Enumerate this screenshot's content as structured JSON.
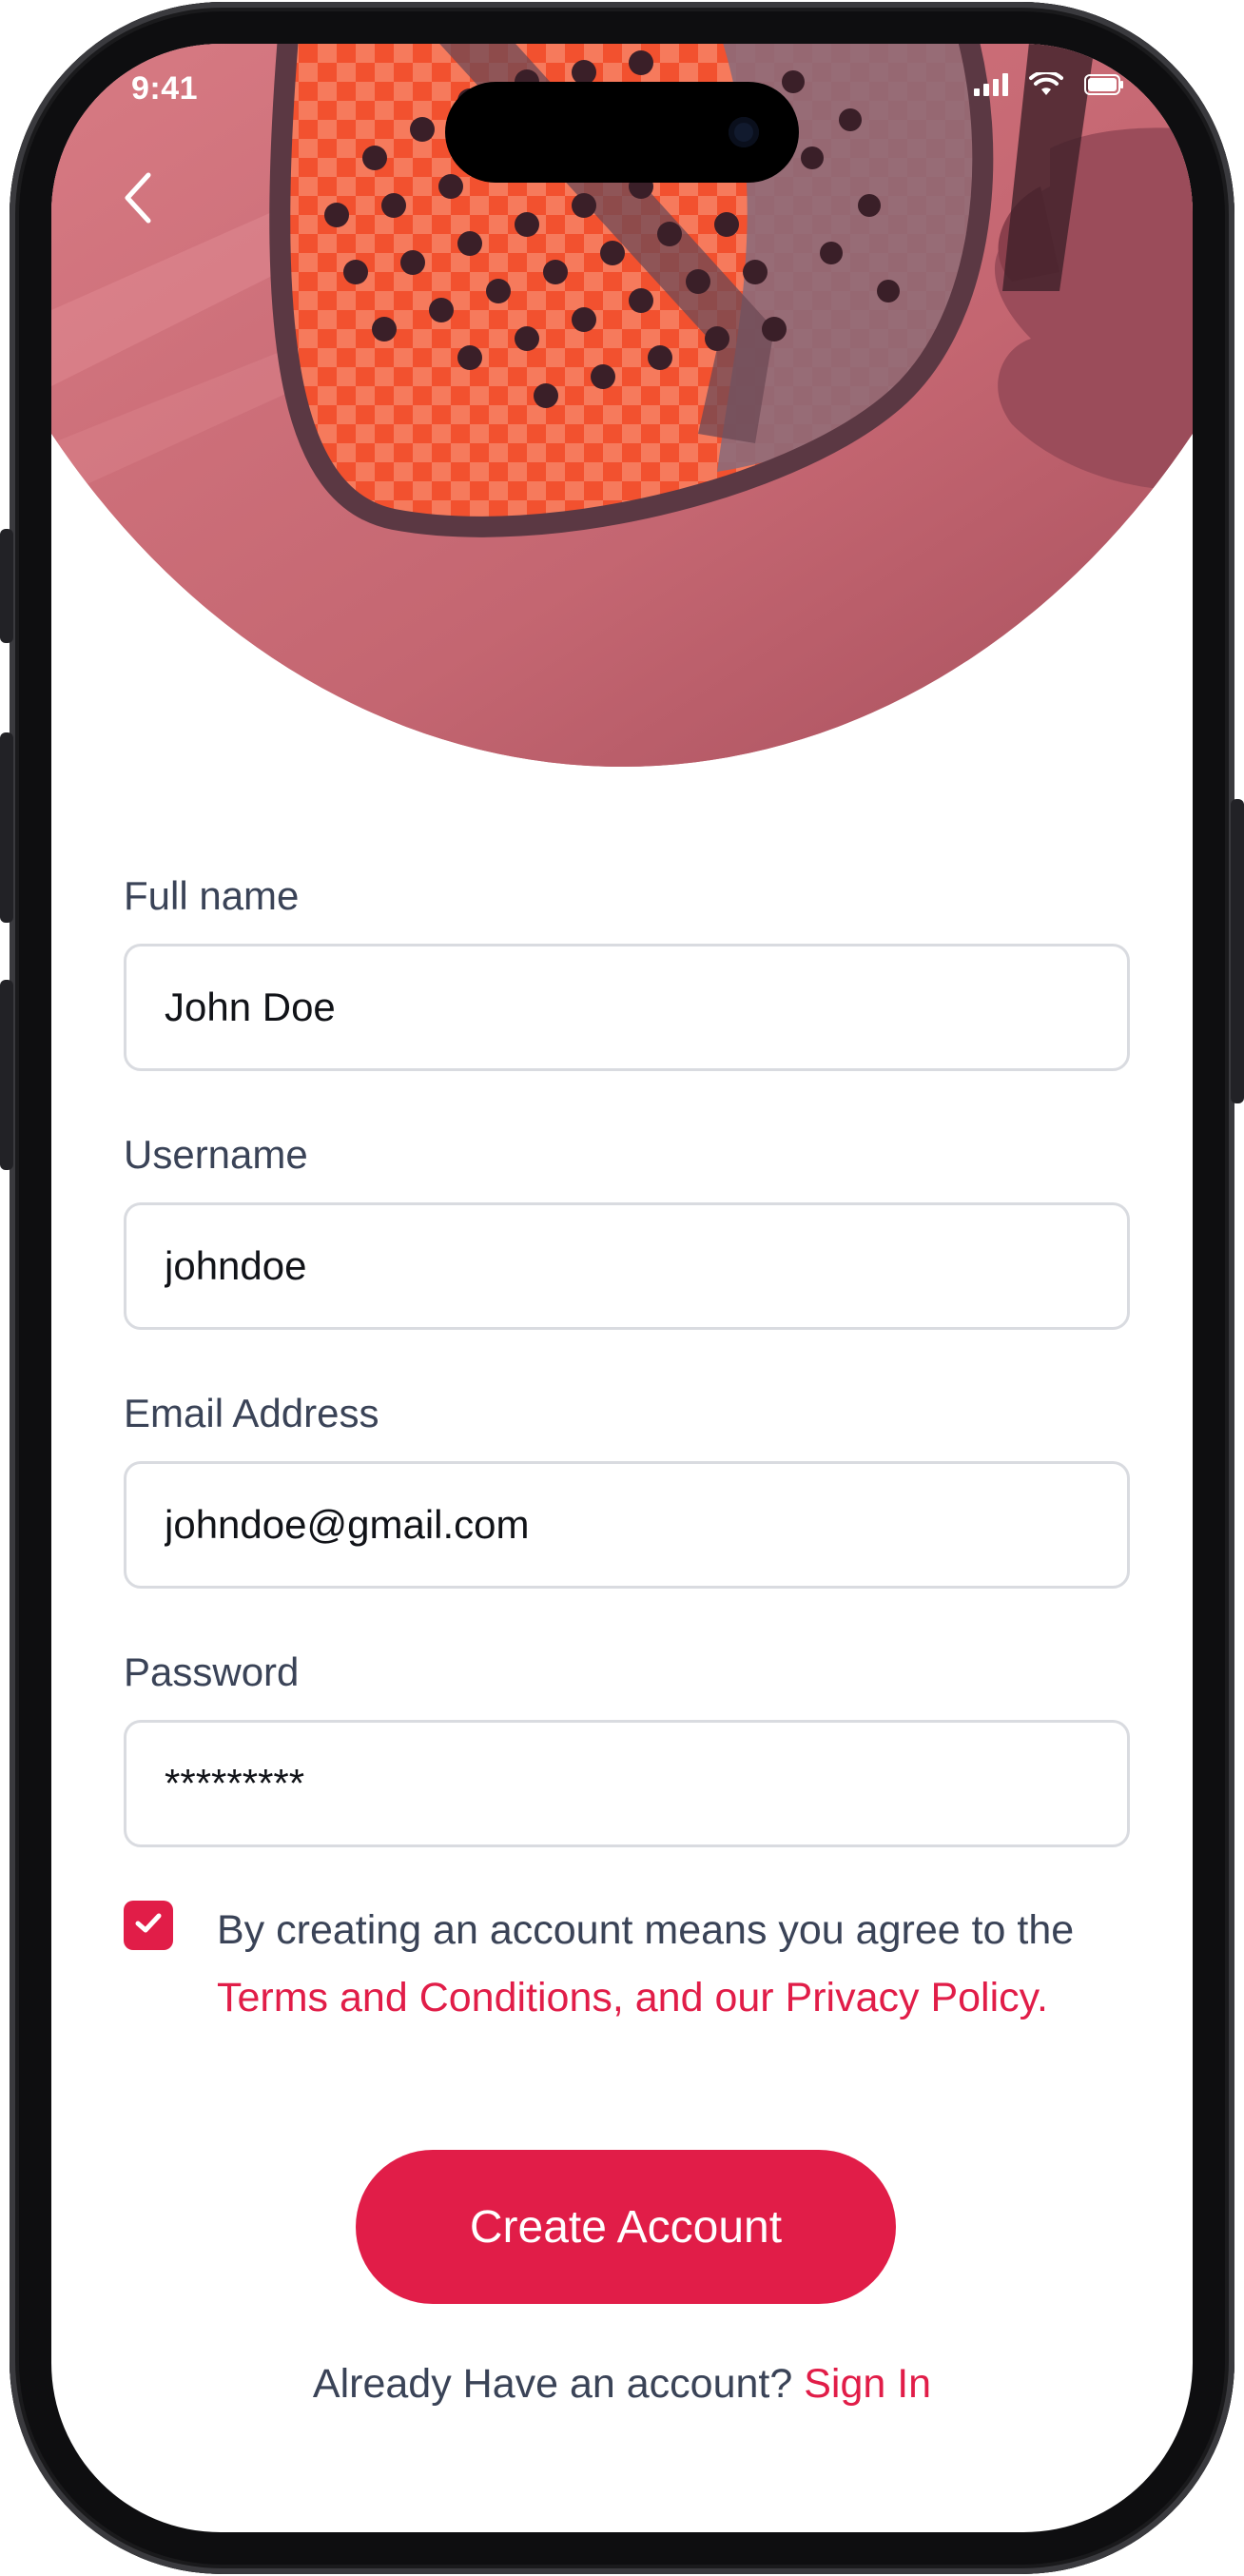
{
  "status_bar": {
    "time": "9:41",
    "signal_icon": "cellular-signal-icon",
    "wifi_icon": "wifi-icon",
    "battery_icon": "battery-icon"
  },
  "header": {
    "back_icon": "chevron-left-icon",
    "hero_image": "padel-racket-photo"
  },
  "form": {
    "full_name": {
      "label": "Full name",
      "value": "John Doe"
    },
    "username": {
      "label": "Username",
      "value": "johndoe"
    },
    "email": {
      "label": "Email Address",
      "value": "johndoe@gmail.com"
    },
    "password": {
      "label": "Password",
      "value": "*********"
    }
  },
  "terms": {
    "checked": true,
    "text_prefix": "By creating an account means you agree to the ",
    "link_text": "Terms and Conditions, and our Privacy Policy."
  },
  "actions": {
    "create_account_label": "Create Account",
    "signin_prompt": "Already Have an account? ",
    "signin_link": "Sign In"
  },
  "colors": {
    "accent": "#e11d48",
    "label_text": "#3a4357",
    "input_border": "#d9dbe0",
    "hero_tint": "#c8636d"
  }
}
